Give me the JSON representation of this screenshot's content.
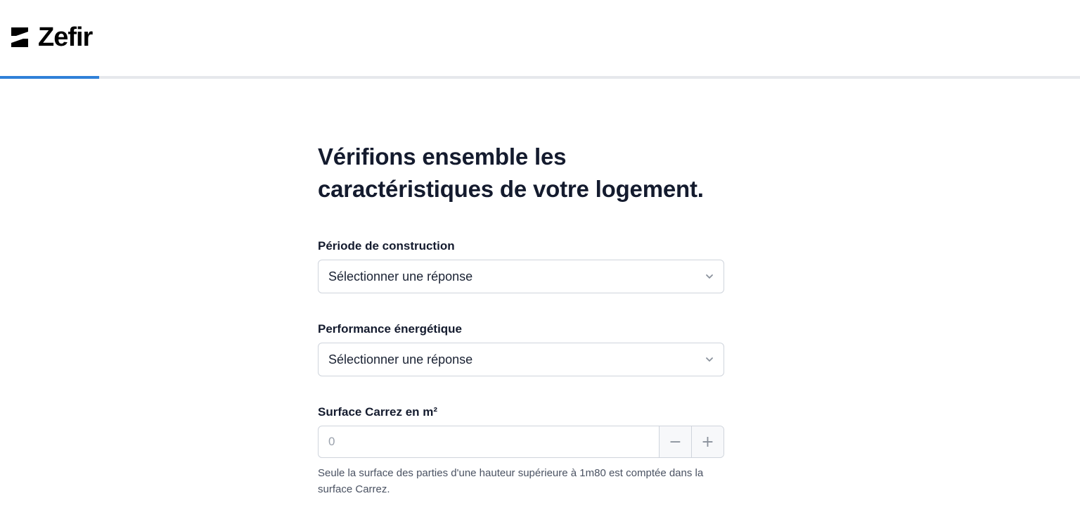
{
  "brand": {
    "name": "Zefir",
    "logo_color": "#000000"
  },
  "progress": {
    "value_percent": 9.2,
    "color": "#2f80d8"
  },
  "form": {
    "title_line1": "Vérifions ensemble les",
    "title_line2": "caractéristiques de votre logement.",
    "construction": {
      "label": "Période de construction",
      "selected": "Sélectionner une réponse"
    },
    "energy": {
      "label": "Performance énergétique",
      "selected": "Sélectionner une réponse"
    },
    "surface": {
      "label": "Surface Carrez en m²",
      "placeholder": "0",
      "decrement": "−",
      "increment": "+",
      "help": "Seule la surface des parties d'une hauteur supérieure à 1m80 est comptée dans la surface Carrez."
    }
  }
}
